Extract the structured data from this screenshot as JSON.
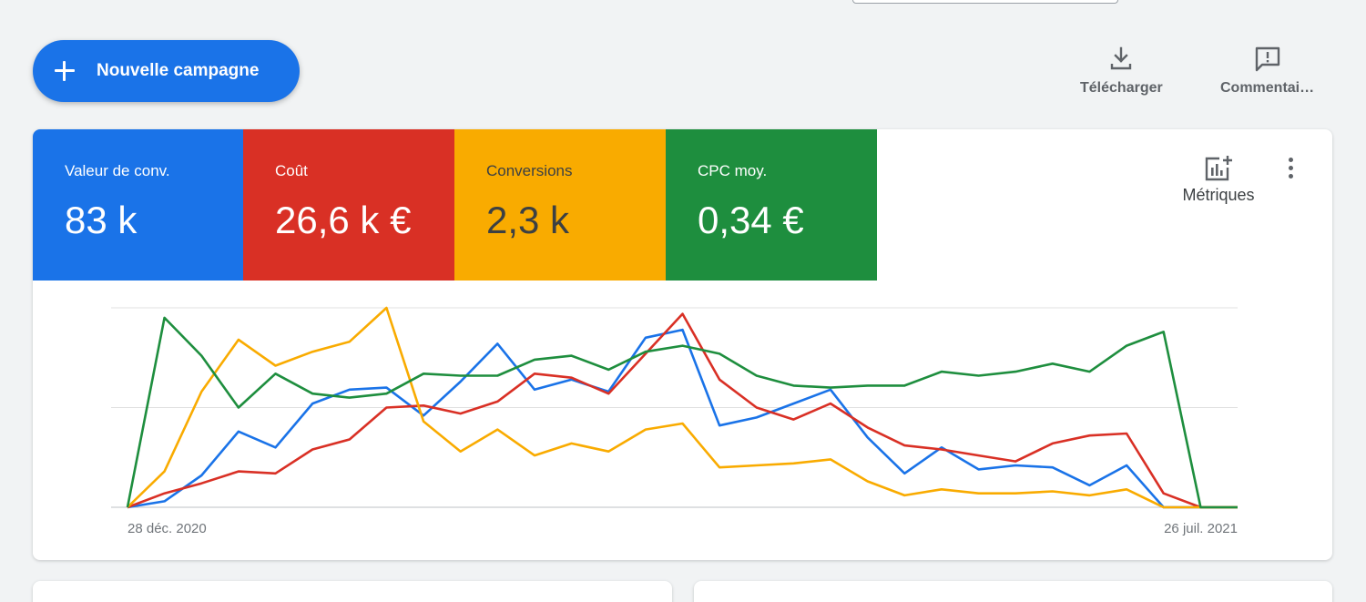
{
  "toolbar": {
    "new_campaign_label": "Nouvelle campagne",
    "download_label": "Télécharger",
    "comments_label": "Commentai…"
  },
  "scorecards": [
    {
      "label": "Valeur de conv.",
      "value": "83 k",
      "color": "#1a73e8"
    },
    {
      "label": "Coût",
      "value": "26,6 k €",
      "color": "#d93025"
    },
    {
      "label": "Conversions",
      "value": "2,3 k",
      "color": "#f9ab00"
    },
    {
      "label": "CPC moy.",
      "value": "0,34 €",
      "color": "#1e8e3e"
    }
  ],
  "card_actions": {
    "metrics_label": "Métriques",
    "more_icon": "more-vert-icon"
  },
  "chart_data": {
    "type": "line",
    "x_start_label": "28 déc. 2020",
    "x_end_label": "26 juil. 2021",
    "x": [
      "2020-12-28",
      "2021-01-04",
      "2021-01-11",
      "2021-01-18",
      "2021-01-25",
      "2021-02-01",
      "2021-02-08",
      "2021-02-15",
      "2021-02-22",
      "2021-03-01",
      "2021-03-08",
      "2021-03-15",
      "2021-03-22",
      "2021-03-29",
      "2021-04-05",
      "2021-04-12",
      "2021-04-19",
      "2021-04-26",
      "2021-05-03",
      "2021-05-10",
      "2021-05-17",
      "2021-05-24",
      "2021-05-31",
      "2021-06-07",
      "2021-06-14",
      "2021-06-21",
      "2021-06-28",
      "2021-07-05",
      "2021-07-12",
      "2021-07-19",
      "2021-07-26"
    ],
    "ylim": [
      0,
      100
    ],
    "grid": true,
    "series": [
      {
        "color": "#1a73e8",
        "values": [
          0,
          3,
          16,
          38,
          30,
          52,
          59,
          60,
          46,
          63,
          82,
          59,
          64,
          58,
          85,
          89,
          41,
          45,
          52,
          59,
          35,
          17,
          30,
          19,
          21,
          20,
          11,
          21,
          0,
          0,
          0
        ]
      },
      {
        "color": "#d93025",
        "values": [
          0,
          7,
          12,
          18,
          17,
          29,
          34,
          50,
          51,
          47,
          53,
          67,
          65,
          57,
          77,
          97,
          64,
          50,
          44,
          52,
          40,
          31,
          29,
          26,
          23,
          32,
          36,
          37,
          7,
          0,
          0
        ]
      },
      {
        "color": "#f9ab00",
        "values": [
          0,
          18,
          58,
          84,
          71,
          78,
          83,
          100,
          43,
          28,
          39,
          26,
          32,
          28,
          39,
          42,
          20,
          21,
          22,
          24,
          13,
          6,
          9,
          7,
          7,
          8,
          6,
          9,
          0,
          0,
          0
        ]
      },
      {
        "color": "#1e8e3e",
        "values": [
          0,
          95,
          76,
          50,
          67,
          57,
          55,
          57,
          67,
          66,
          66,
          74,
          76,
          69,
          78,
          81,
          77,
          66,
          61,
          60,
          61,
          61,
          68,
          66,
          68,
          72,
          68,
          81,
          88,
          0,
          0
        ]
      }
    ]
  }
}
